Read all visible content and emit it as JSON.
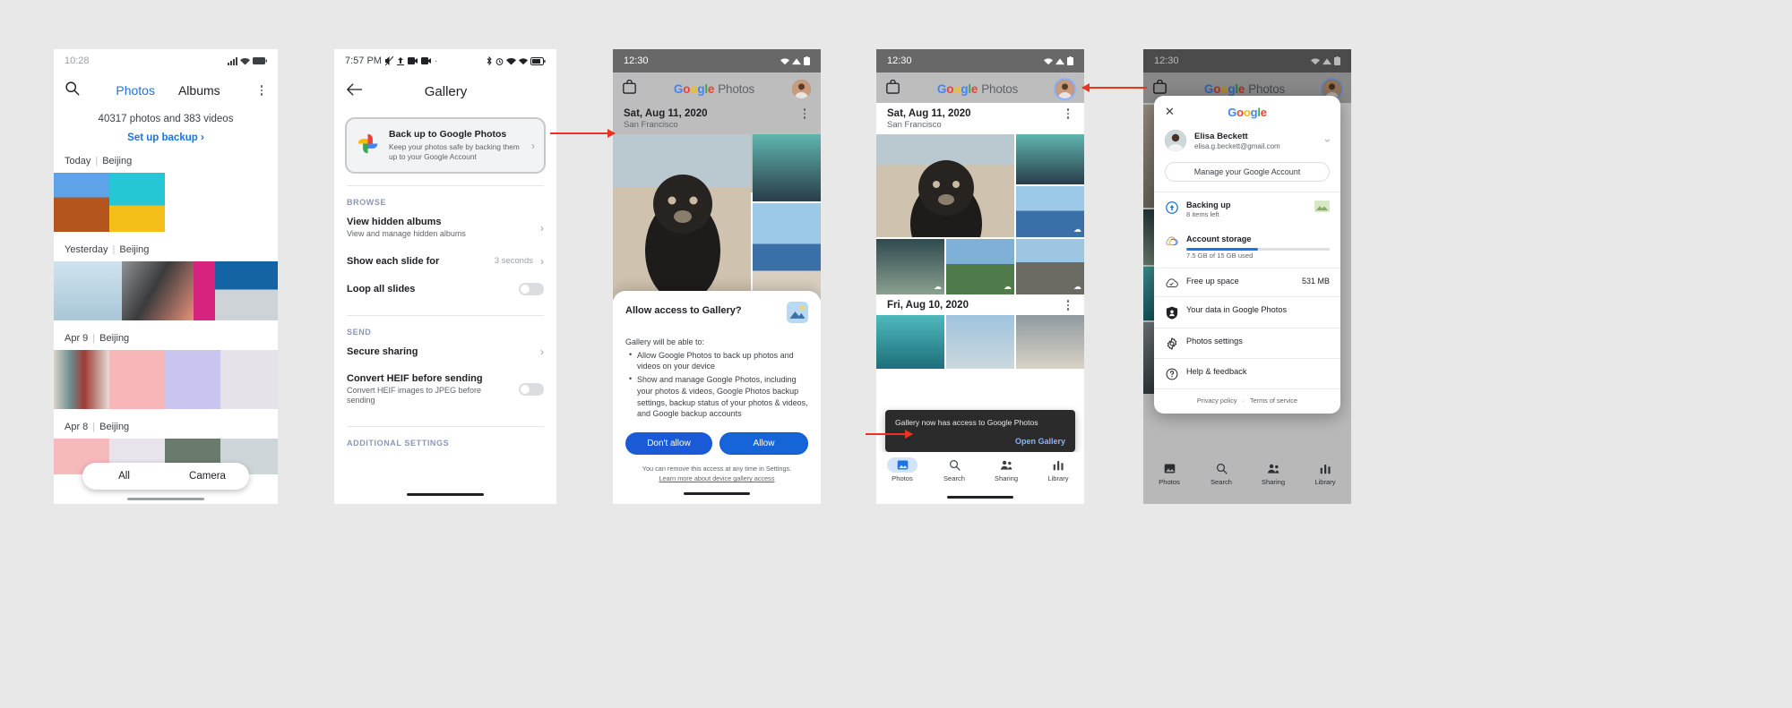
{
  "phone1": {
    "status": {
      "time": "10:28"
    },
    "tabs": [
      {
        "label": "Photos",
        "active": true
      },
      {
        "label": "Albums",
        "active": false
      }
    ],
    "count_text": "40317 photos and 383 videos",
    "setup_backup": "Set up backup",
    "sections": [
      {
        "date": "Today",
        "place": "Beijing"
      },
      {
        "date": "Yesterday",
        "place": "Beijing"
      },
      {
        "date": "Apr 9",
        "place": "Beijing"
      },
      {
        "date": "Apr 8",
        "place": "Beijing"
      }
    ],
    "filter_pill": [
      "All",
      "Camera"
    ],
    "search_icon": "search-icon",
    "overflow_icon": "kebab-menu-icon"
  },
  "phone2": {
    "status": {
      "time": "7:57 PM"
    },
    "title": "Gallery",
    "back_icon": "back-arrow-icon",
    "promo": {
      "title": "Back up to Google Photos",
      "subtitle": "Keep your photos safe by backing them up to your Google Account",
      "icon": "google-photos-pinwheel-icon"
    },
    "section_browse": "BROWSE",
    "section_send": "SEND",
    "section_additional": "ADDITIONAL SETTINGS",
    "items": [
      {
        "title": "View hidden albums",
        "subtitle": "View and manage hidden albums",
        "value": "",
        "control": "chevron"
      },
      {
        "title": "Show each slide for",
        "subtitle": "",
        "value": "3 seconds",
        "control": "chevron"
      },
      {
        "title": "Loop all slides",
        "subtitle": "",
        "value": "",
        "control": "toggle-off"
      },
      {
        "title": "Secure sharing",
        "subtitle": "",
        "value": "",
        "control": "chevron"
      },
      {
        "title": "Convert HEIF before sending",
        "subtitle": "Convert HEIF images to JPEG before sending",
        "value": "",
        "control": "toggle-off"
      }
    ]
  },
  "phone3": {
    "status": {
      "time": "12:30"
    },
    "app_name_1": "Google",
    "app_name_2": "Photos",
    "date": "Sat, Aug 11, 2020",
    "place": "San Francisco",
    "dialog": {
      "title": "Allow access to Gallery?",
      "lead": "Gallery will be able to:",
      "bullets": [
        "Allow Google Photos to back up photos and videos on your device",
        "Show and manage Google Photos, including your photos & videos, Google Photos backup settings, backup status of your photos & videos, and Google backup accounts"
      ],
      "deny_label": "Don't allow",
      "allow_label": "Allow",
      "footer_line1": "You can remove this access at any time in Settings.",
      "footer_link": "Learn more about device gallery access",
      "icon": "gallery-image-icon"
    }
  },
  "phone4": {
    "status": {
      "time": "12:30"
    },
    "app_name_1": "Google",
    "app_name_2": "Photos",
    "date": "Sat, Aug 11, 2020",
    "place": "San Francisco",
    "date2": "Fri, Aug 10, 2020",
    "snackbar": {
      "message": "Gallery now has access to Google Photos",
      "action": "Open Gallery"
    },
    "nav": [
      {
        "label": "Photos",
        "icon": "photos-icon",
        "active": true
      },
      {
        "label": "Search",
        "icon": "search-icon",
        "active": false
      },
      {
        "label": "Sharing",
        "icon": "sharing-people-icon",
        "active": false
      },
      {
        "label": "Library",
        "icon": "library-bars-icon",
        "active": false
      }
    ]
  },
  "phone5": {
    "status": {
      "time": "12:30"
    },
    "app_name_1": "Google",
    "app_name_2": "Photos",
    "panel": {
      "close_icon": "close-x-icon",
      "brand": "Google",
      "user_name": "Elisa Beckett",
      "user_email": "elisa.g.beckett@gmail.com",
      "manage_label": "Manage your Google Account",
      "expand_icon": "chevron-down-icon",
      "backing_up_title": "Backing up",
      "backing_up_sub": "8 items left",
      "storage_title": "Account storage",
      "storage_sub": "7.5 GB of 15 GB used",
      "storage_percent": 50,
      "rows": [
        {
          "label": "Free up space",
          "value": "531 MB",
          "icon": "cloud-check-icon"
        },
        {
          "label": "Your data in Google Photos",
          "value": "",
          "icon": "shield-person-icon"
        },
        {
          "label": "Photos settings",
          "value": "",
          "icon": "gear-icon"
        },
        {
          "label": "Help & feedback",
          "value": "",
          "icon": "help-circle-icon"
        }
      ],
      "footer": {
        "privacy": "Privacy policy",
        "dot": "·",
        "terms": "Terms of service"
      }
    },
    "nav": [
      {
        "label": "Photos"
      },
      {
        "label": "Search"
      },
      {
        "label": "Sharing"
      },
      {
        "label": "Library"
      }
    ]
  },
  "colors": {
    "accent_blue": "#1a73e8",
    "arrow_red": "#ea3323",
    "google_blue": "#4285f4",
    "google_red": "#ea4335",
    "google_yellow": "#fbbc04",
    "google_green": "#34a853"
  }
}
